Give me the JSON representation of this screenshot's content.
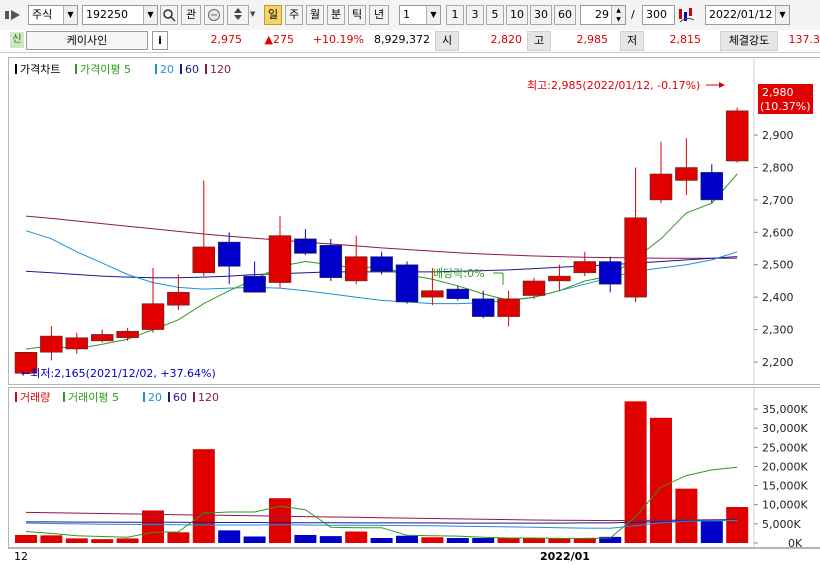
{
  "toolbar": {
    "market": "주식",
    "code": "192250",
    "btn_gwan": "관",
    "periods": [
      "일",
      "주",
      "월",
      "분",
      "틱",
      "년"
    ],
    "active_period": "일",
    "unit_value": "1",
    "quick_units": [
      "1",
      "3",
      "5",
      "10",
      "30",
      "60"
    ],
    "count": "29",
    "slash": "/",
    "total": "300",
    "date": "2022/01/12"
  },
  "quote": {
    "flag": "신",
    "name": "케이사인",
    "info": "i",
    "price": "2,975",
    "change": "▲275",
    "rate": "+10.19%",
    "volume": "8,929,372",
    "open_label": "시",
    "open": "2,820",
    "high_label": "고",
    "high": "2,985",
    "low_label": "저",
    "low": "2,815",
    "strength_label": "체결강도",
    "strength": "137.3"
  },
  "price_panel": {
    "title": "가격차트",
    "ma_label": "가격이평",
    "ma_periods": [
      "5",
      "20",
      "60",
      "120"
    ],
    "max_note": "최고:2,985(2022/01/12, -0.17%)",
    "min_note": "최저:2,165(2021/12/02, +37.64%)",
    "dividend_note": "배당락:0%",
    "current_price": "2,980",
    "current_rate": "(10.37%)",
    "y_ticks": [
      "2,900",
      "2,800",
      "2,700",
      "2,600",
      "2,500",
      "2,400",
      "2,300",
      "2,200"
    ],
    "y_tick_values": [
      2900,
      2800,
      2700,
      2600,
      2500,
      2400,
      2300,
      2200
    ],
    "y_top_partial": "2,980"
  },
  "volume_panel": {
    "title": "거래량",
    "ma_label": "거래이평",
    "ma_periods": [
      "5",
      "20",
      "60",
      "120"
    ],
    "y_ticks": [
      "35,000K",
      "30,000K",
      "25,000K",
      "20,000K",
      "15,000K",
      "10,000K",
      "5,000K",
      "0K"
    ],
    "y_tick_values": [
      35000,
      30000,
      25000,
      20000,
      15000,
      10000,
      5000,
      0
    ]
  },
  "x_axis": {
    "left_label": "12",
    "month_label": "2022/01"
  },
  "colors": {
    "up": "#e00000",
    "down": "#0000c8",
    "ma5": "#2e9a1e",
    "ma20": "#1e8fd8",
    "ma60": "#1a1a8c",
    "ma120": "#8c1a4a"
  },
  "chart_data": {
    "type": "candlestick",
    "candles": [
      {
        "o": 2165,
        "h": 2190,
        "l": 2165,
        "c": 2230
      },
      {
        "o": 2230,
        "h": 2310,
        "l": 2205,
        "c": 2280
      },
      {
        "o": 2240,
        "h": 2290,
        "l": 2225,
        "c": 2275
      },
      {
        "o": 2265,
        "h": 2300,
        "l": 2260,
        "c": 2285
      },
      {
        "o": 2275,
        "h": 2305,
        "l": 2265,
        "c": 2295
      },
      {
        "o": 2300,
        "h": 2490,
        "l": 2290,
        "c": 2380
      },
      {
        "o": 2375,
        "h": 2470,
        "l": 2360,
        "c": 2415
      },
      {
        "o": 2475,
        "h": 2760,
        "l": 2465,
        "c": 2555
      },
      {
        "o": 2570,
        "h": 2600,
        "l": 2440,
        "c": 2495
      },
      {
        "o": 2465,
        "h": 2510,
        "l": 2420,
        "c": 2415
      },
      {
        "o": 2445,
        "h": 2650,
        "l": 2430,
        "c": 2590
      },
      {
        "o": 2580,
        "h": 2610,
        "l": 2530,
        "c": 2535
      },
      {
        "o": 2560,
        "h": 2580,
        "l": 2450,
        "c": 2460
      },
      {
        "o": 2450,
        "h": 2590,
        "l": 2440,
        "c": 2525
      },
      {
        "o": 2525,
        "h": 2540,
        "l": 2470,
        "c": 2480
      },
      {
        "o": 2500,
        "h": 2510,
        "l": 2380,
        "c": 2385
      },
      {
        "o": 2400,
        "h": 2490,
        "l": 2375,
        "c": 2420
      },
      {
        "o": 2425,
        "h": 2435,
        "l": 2390,
        "c": 2395
      },
      {
        "o": 2395,
        "h": 2420,
        "l": 2335,
        "c": 2340
      },
      {
        "o": 2340,
        "h": 2420,
        "l": 2310,
        "c": 2395
      },
      {
        "o": 2405,
        "h": 2460,
        "l": 2395,
        "c": 2450
      },
      {
        "o": 2450,
        "h": 2500,
        "l": 2420,
        "c": 2465
      },
      {
        "o": 2475,
        "h": 2540,
        "l": 2465,
        "c": 2510
      },
      {
        "o": 2510,
        "h": 2525,
        "l": 2415,
        "c": 2440
      },
      {
        "o": 2400,
        "h": 2800,
        "l": 2385,
        "c": 2645
      },
      {
        "o": 2700,
        "h": 2880,
        "l": 2690,
        "c": 2780
      },
      {
        "o": 2760,
        "h": 2890,
        "l": 2715,
        "c": 2800
      },
      {
        "o": 2785,
        "h": 2810,
        "l": 2690,
        "c": 2700
      },
      {
        "o": 2820,
        "h": 2985,
        "l": 2815,
        "c": 2975
      }
    ],
    "ma5": [
      2240,
      2250,
      2240,
      2255,
      2270,
      2300,
      2330,
      2380,
      2420,
      2455,
      2495,
      2510,
      2500,
      2490,
      2495,
      2470,
      2455,
      2435,
      2410,
      2390,
      2400,
      2420,
      2450,
      2465,
      2520,
      2580,
      2660,
      2690,
      2780
    ],
    "ma20": [
      2605,
      2580,
      2540,
      2505,
      2470,
      2445,
      2430,
      2425,
      2428,
      2430,
      2428,
      2420,
      2410,
      2400,
      2390,
      2385,
      2380,
      2380,
      2383,
      2390,
      2400,
      2420,
      2440,
      2460,
      2480,
      2490,
      2500,
      2515,
      2540
    ],
    "ma60": [
      2480,
      2475,
      2470,
      2465,
      2462,
      2460,
      2460,
      2462,
      2465,
      2470,
      2472,
      2475,
      2478,
      2478,
      2478,
      2478,
      2478,
      2480,
      2482,
      2484,
      2488,
      2492,
      2496,
      2500,
      2505,
      2510,
      2515,
      2520,
      2525
    ],
    "ma120": [
      2650,
      2643,
      2635,
      2627,
      2619,
      2611,
      2603,
      2595,
      2588,
      2582,
      2576,
      2570,
      2564,
      2558,
      2552,
      2547,
      2542,
      2537,
      2533,
      2530,
      2527,
      2525,
      2523,
      2522,
      2521,
      2520,
      2520,
      2520,
      2520
    ],
    "volume": [
      2100,
      2000,
      1200,
      1000,
      1200,
      8500,
      2800,
      24500,
      3300,
      1700,
      11700,
      2100,
      1800,
      3000,
      1300,
      1900,
      1500,
      1300,
      1300,
      1300,
      1200,
      1200,
      1300,
      1600,
      37000,
      32700,
      14200,
      5700,
      9400
    ],
    "vma5": [
      3000,
      2500,
      1900,
      1700,
      1500,
      2800,
      2900,
      7800,
      8100,
      8100,
      9600,
      8700,
      4100,
      4000,
      4000,
      2000,
      1900,
      1800,
      1500,
      1300,
      1300,
      1200,
      1200,
      1300,
      6900,
      14600,
      17600,
      19100,
      19800
    ],
    "vma20": [
      5200,
      5100,
      5000,
      4900,
      4850,
      4800,
      4750,
      4700,
      4700,
      4700,
      4750,
      4700,
      4650,
      4650,
      4600,
      4550,
      4500,
      4400,
      4300,
      4200,
      4100,
      4000,
      3900,
      3850,
      4500,
      5300,
      5700,
      5800,
      5900
    ],
    "vma60": [
      5500,
      5500,
      5450,
      5450,
      5400,
      5400,
      5400,
      5350,
      5350,
      5350,
      5300,
      5300,
      5300,
      5250,
      5250,
      5250,
      5250,
      5200,
      5200,
      5200,
      5200,
      5200,
      5250,
      5250,
      5400,
      5600,
      5800,
      5900,
      6100
    ],
    "vma120": [
      8000,
      7900,
      7800,
      7700,
      7600,
      7500,
      7400,
      7300,
      7200,
      7100,
      7000,
      6900,
      6800,
      6700,
      6600,
      6500,
      6400,
      6300,
      6200,
      6100,
      6000,
      5950,
      5900,
      5850,
      5900,
      5950,
      6000,
      6050,
      6100
    ]
  }
}
